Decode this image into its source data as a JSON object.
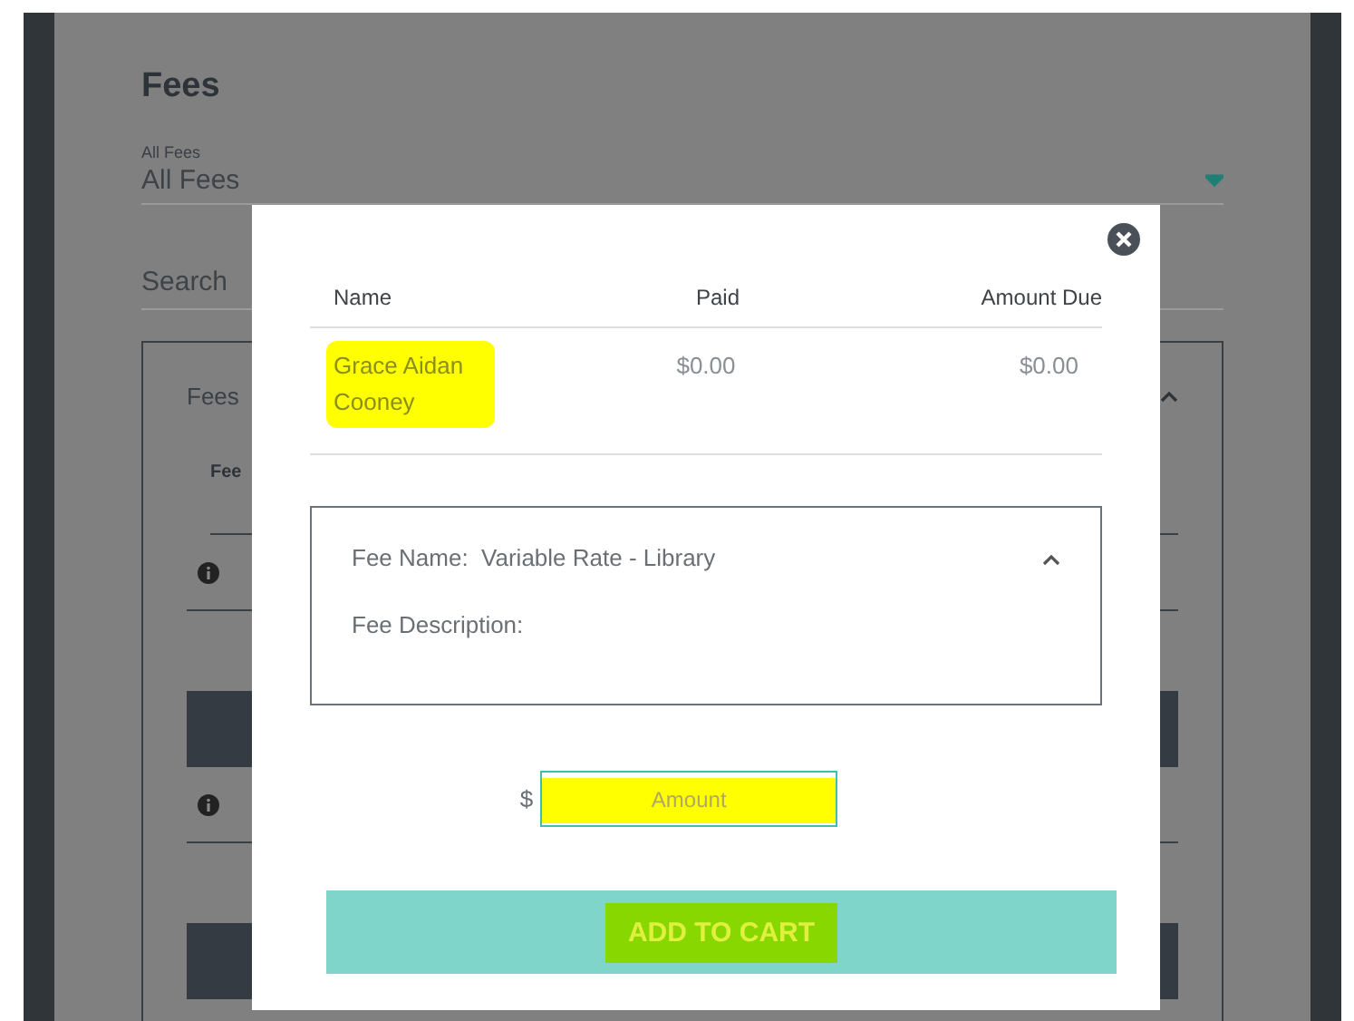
{
  "page": {
    "title": "Fees",
    "filter": {
      "label": "All Fees",
      "value": "All Fees"
    },
    "search": {
      "placeholder": "Search"
    },
    "card": {
      "title": "Fees",
      "expanded": true,
      "column_1": "Fee"
    }
  },
  "dialog": {
    "columns": [
      "Name",
      "Paid",
      "Amount Due"
    ],
    "rows": [
      {
        "cells": [
          "Grace Aidan Cooney",
          "$0.00",
          "$0.00"
        ],
        "highlighted": [
          true,
          false,
          false
        ]
      }
    ],
    "fee": {
      "name_label": "Fee Name:",
      "name": "Variable Rate - Library",
      "description_label": "Fee Description:",
      "expanded": true
    },
    "amount": {
      "currency": "$",
      "placeholder": "Amount",
      "highlighted": true
    },
    "button": {
      "label": "ADD TO CART",
      "highlighted": true
    }
  }
}
